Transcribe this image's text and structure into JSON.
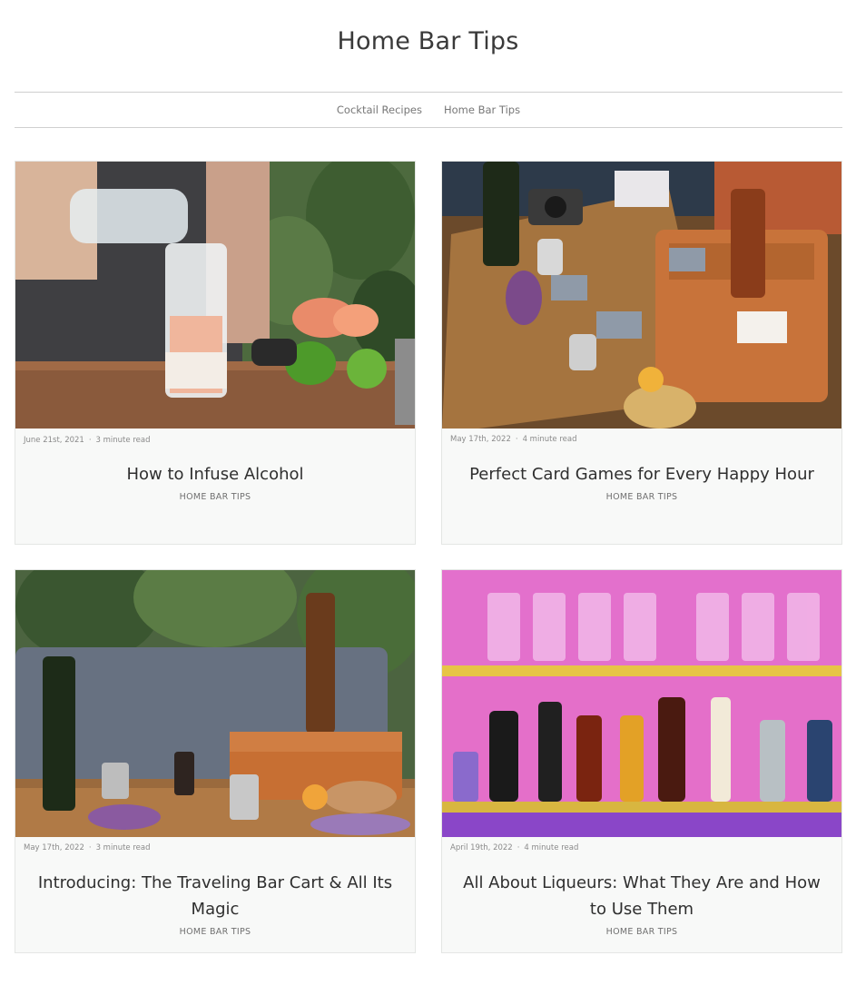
{
  "site": {
    "title": "Home Bar Tips"
  },
  "nav": {
    "items": [
      {
        "label": "Cocktail Recipes"
      },
      {
        "label": "Home Bar Tips"
      }
    ]
  },
  "meta_separator": "·",
  "posts": [
    {
      "date": "June 21st, 2021",
      "read_time": "3 minute read",
      "title": "How to Infuse Alcohol",
      "category": "HOME BAR TIPS",
      "image_icon": "infusion-jar-photo"
    },
    {
      "date": "May 17th, 2022",
      "read_time": "4 minute read",
      "title": "Perfect Card Games for Every Happy Hour",
      "category": "HOME BAR TIPS",
      "image_icon": "card-games-photo"
    },
    {
      "date": "May 17th, 2022",
      "read_time": "3 minute read",
      "title": "Introducing: The Traveling Bar Cart & All Its Magic",
      "category": "HOME BAR TIPS",
      "image_icon": "bar-cart-photo"
    },
    {
      "date": "April 19th, 2022",
      "read_time": "4 minute read",
      "title": "All About Liqueurs: What They Are and How to Use Them",
      "category": "HOME BAR TIPS",
      "image_icon": "liqueur-shelf-photo"
    }
  ],
  "colors": {
    "text": "#333333",
    "card_bg": "#f8f9f8",
    "border": "#cfcfcf",
    "shelf_pink": "#e85fd0"
  }
}
